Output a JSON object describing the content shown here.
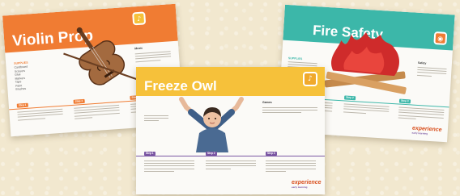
{
  "cards": {
    "violin": {
      "title": "Violin Prop",
      "category": "Music",
      "materials_head": "SUPPLIES",
      "materials": [
        "Cardboard",
        "Scissors",
        "Glue",
        "Markers",
        "Tape",
        "Paint",
        "Brushes"
      ],
      "step1": "Step 1",
      "step2": "Step 2",
      "step3": "Step 3",
      "band_color": "#f07c33",
      "logo_icon": "violin-logo-icon"
    },
    "fire": {
      "title": "Fire Safety",
      "category": "Safety",
      "materials_head": "SUPPLIES",
      "step1": "Step 1",
      "step2": "Step 2",
      "step3": "Step 3",
      "band_color": "#3cb7a9",
      "logo_icon": "flame-logo-icon",
      "brand": "experience",
      "brand_sub": "early learning"
    },
    "owl": {
      "title": "Freeze Owl",
      "category": "Games",
      "step1": "Step 1",
      "step2": "Step 2",
      "step3": "Step 3",
      "band_color": "#f6c13a",
      "bar_color": "#7a56a3",
      "logo_icon": "owl-logo-icon",
      "brand": "experience",
      "brand_sub": "early learning"
    }
  }
}
